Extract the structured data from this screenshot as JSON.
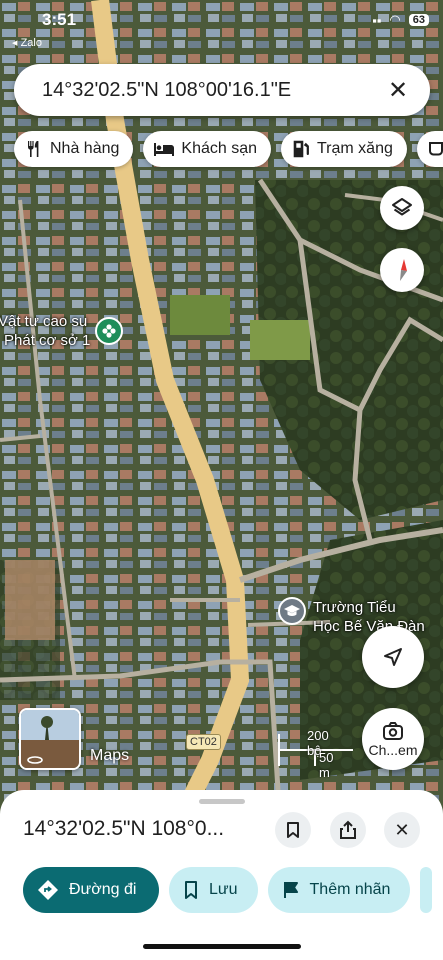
{
  "status_bar": {
    "time": "3:51",
    "back_app": "◂ Zalo",
    "battery": "63"
  },
  "search": {
    "value": "14°32'02.5\"N 108°00'16.1\"E"
  },
  "chips": [
    {
      "label": "Nhà hàng",
      "icon": "fork-knife-icon"
    },
    {
      "label": "Khách sạn",
      "icon": "bed-icon"
    },
    {
      "label": "Trạm xăng",
      "icon": "gas-pump-icon"
    },
    {
      "label": "",
      "icon": "coffee-icon"
    }
  ],
  "map": {
    "places": [
      {
        "name_line1": "Vật tư cao su",
        "name_line2": "Phát cơ sở 1"
      },
      {
        "name_line1": "Trường Tiểu",
        "name_line2": "Học Bế Văn Đàn"
      }
    ],
    "road_label": "CT02",
    "scale": {
      "top": "200 bộ",
      "bottom": "50 m"
    },
    "thumbnail_label": "Maps",
    "camera_label": "Ch...em"
  },
  "sheet": {
    "title": "14°32'02.5\"N 108°0...",
    "actions": [
      {
        "label": "Đường đi",
        "icon": "directions-icon"
      },
      {
        "label": "Lưu",
        "icon": "bookmark-icon"
      },
      {
        "label": "Thêm nhãn",
        "icon": "flag-icon"
      }
    ]
  },
  "colors": {
    "primary": "#0b6b72",
    "secondary": "#c8eef3",
    "road": "#e8c987"
  }
}
